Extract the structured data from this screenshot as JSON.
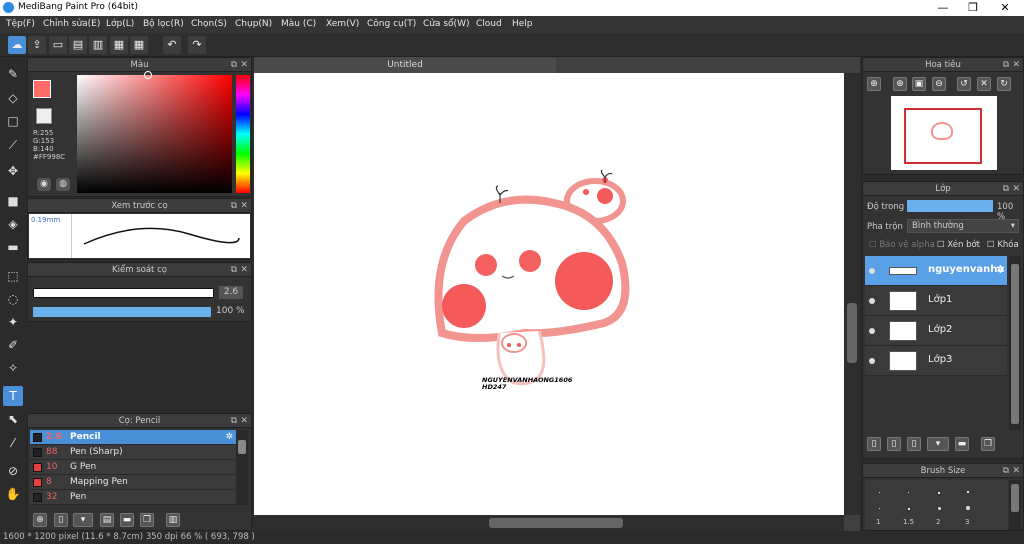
{
  "app": {
    "title": "MediBang Paint Pro (64bit)"
  },
  "menu": [
    "Tệp(F)",
    "Chỉnh sửa(E)",
    "Lớp(L)",
    "Bộ lọc(R)",
    "Chọn(S)",
    "Chụp(N)",
    "Màu (C)",
    "Xem(V)",
    "Công cụ(T)",
    "Cửa sổ(W)",
    "Cloud",
    "Help"
  ],
  "color_panel": {
    "title": "Màu",
    "r": "R:255",
    "g": "G:153",
    "b": "B:140",
    "hex": "#FF998C",
    "accent": "#FF998C"
  },
  "brush_preview": {
    "title": "Xem trước cọ",
    "size": "0.19mm"
  },
  "brush_control": {
    "title": "Kiểm soát cọ",
    "size_value": "2.6",
    "opacity_value": "100 %"
  },
  "brush_list": {
    "title": "Cọ: Pencil",
    "items": [
      {
        "size": "2.6",
        "name": "Pencil",
        "color": "#222222"
      },
      {
        "size": "88",
        "name": "Pen (Sharp)",
        "color": "#222222"
      },
      {
        "size": "10",
        "name": "G Pen",
        "color": "#e84040"
      },
      {
        "size": "8",
        "name": "Mapping Pen",
        "color": "#e84040"
      },
      {
        "size": "32",
        "name": "Pen",
        "color": "#222222"
      }
    ]
  },
  "canvas": {
    "tab": "Untitled",
    "sig1": "NGUYENVANHAONG1606",
    "sig2": "HD247"
  },
  "navigator": {
    "title": "Hoa tiêu"
  },
  "layers": {
    "title": "Lớp",
    "opacity_label": "Độ trong",
    "opacity_value": "100 %",
    "blend_label": "Pha trộn",
    "blend_value": "Bình thường",
    "protect_alpha": "Bảo vệ alpha",
    "clipping": "Xén bớt",
    "lock": "Khóa",
    "items": [
      {
        "name": "nguyenvanha"
      },
      {
        "name": "Lớp1"
      },
      {
        "name": "Lớp2"
      },
      {
        "name": "Lớp3"
      }
    ]
  },
  "brush_size": {
    "title": "Brush Size",
    "labels": [
      "1",
      "1.5",
      "2",
      "3"
    ]
  },
  "status": {
    "text": "1600 * 1200 pixel   (11.6 * 8.7cm)   350 dpi   66 %   ( 693, 798 )"
  }
}
